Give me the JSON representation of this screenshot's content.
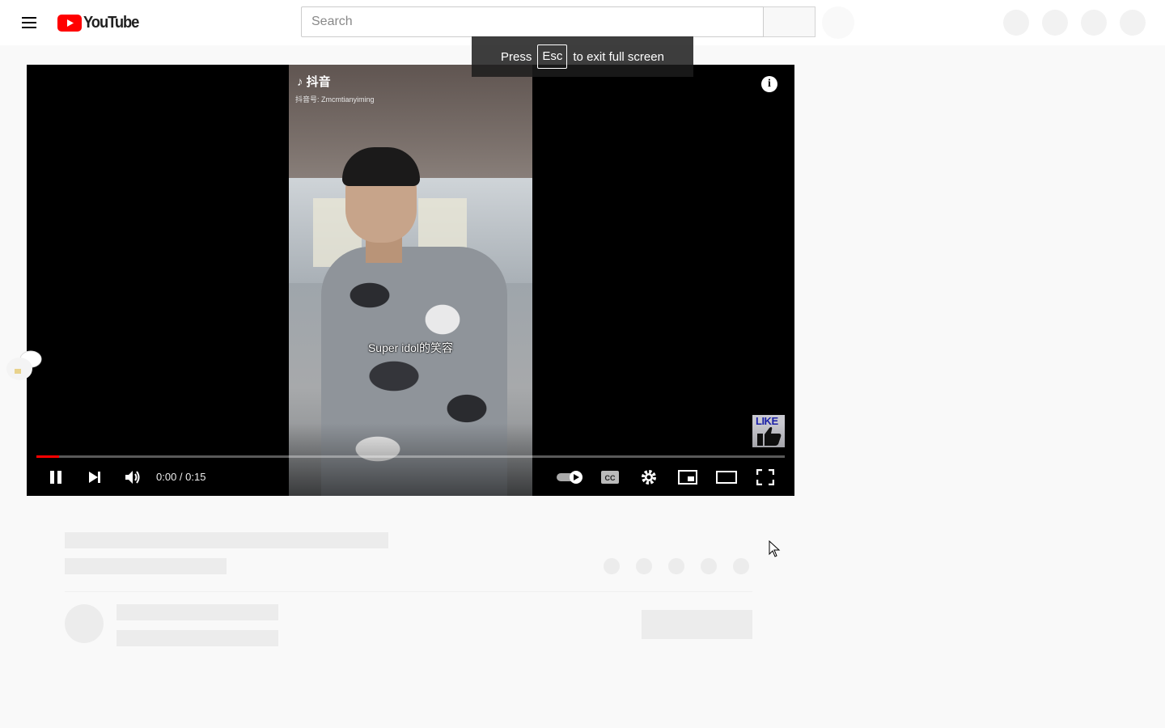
{
  "masthead": {
    "logo_text": "YouTube",
    "search_placeholder": "Search",
    "brand_red": "#ff0000"
  },
  "fullscreen_toast": {
    "prefix": "Press",
    "key": "Esc",
    "suffix": "to exit full screen"
  },
  "video": {
    "brand_tag": "♪ 抖音",
    "brand_sub": "抖音号: Zmcmtianyiming",
    "subtitle": "Super idol的笑容",
    "like_badge": "LIKE",
    "info_icon": "i"
  },
  "controls": {
    "time": "0:00 / 0:15",
    "progress_fraction": 0.03,
    "autoplay": "on",
    "icons": [
      "pause-icon",
      "next-icon",
      "volume-icon",
      "autoplay-toggle-icon",
      "captions-icon",
      "settings-icon",
      "miniplayer-icon",
      "theater-icon",
      "fullscreen-icon"
    ]
  }
}
